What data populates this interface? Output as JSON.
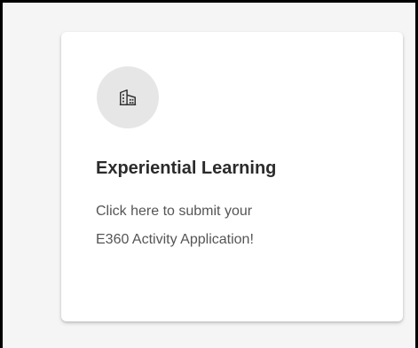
{
  "card": {
    "icon": "office-building-icon",
    "title": "Experiential Learning",
    "description_lines": [
      "Click here to submit your",
      "E360 Activity Application!"
    ]
  },
  "colors": {
    "background": "#f5f5f5",
    "card": "#ffffff",
    "icon_circle": "#e6e6e6",
    "title": "#2b2b2b",
    "description": "#555555"
  }
}
